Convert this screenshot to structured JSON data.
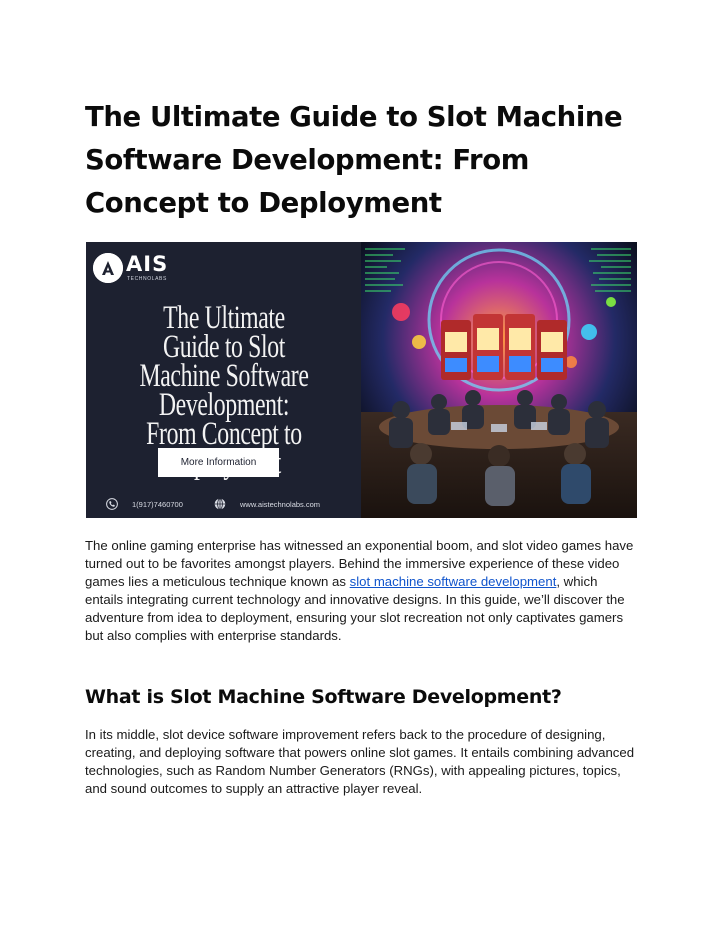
{
  "article": {
    "title": "The Ultimate Guide to Slot Machine Software Development: From Concept to Deployment"
  },
  "banner": {
    "logo_text": "AIS",
    "logo_subtext": "TECHNOLABS",
    "heading": "The Ultimate Guide to Slot Machine Software Development: From Concept to Deployment",
    "button_label": "More Information",
    "phone": "1(917)7460700",
    "website": "www.aistechnolabs.com",
    "colors": {
      "panel": "#1d2130",
      "button": "#ffffff"
    },
    "icons": [
      "logo-icon",
      "phone-icon",
      "globe-icon"
    ]
  },
  "intro": {
    "before_link": "The online gaming enterprise has witnessed an exponential boom, and slot video games have turned out to be favorites amongst players. Behind the immersive experience of these video games lies a meticulous technique known as ",
    "link_text": "slot machine software development",
    "after_link": ", which entails integrating current technology and innovative designs. In this guide, we’ll discover the adventure from idea to deployment, ensuring your slot recreation not only captivates gamers but also complies with enterprise standards."
  },
  "section1": {
    "heading": "What is Slot Machine Software Development?",
    "body": "In its middle, slot device software improvement refers back to the procedure of designing, creating, and deploying software that powers online slot games. It entails combining advanced technologies, such as Random Number Generators (RNGs), with appealing pictures, topics, and sound outcomes to supply an attractive player reveal."
  },
  "colors": {
    "link": "#1155cc",
    "text": "#1a1a1a",
    "heading": "#0b0b0b"
  }
}
